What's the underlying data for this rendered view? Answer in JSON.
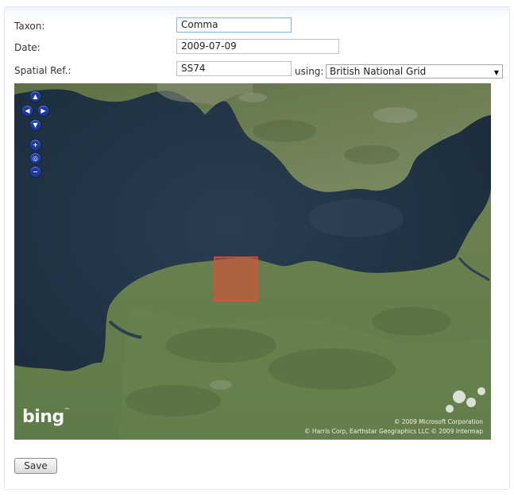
{
  "form": {
    "taxon_label": "Taxon:",
    "taxon_value": "Comma",
    "date_label": "Date:",
    "date_value": "2009-07-09",
    "spatial_label": "Spatial Ref.:",
    "spatial_value": "SS74",
    "using_label": "using:",
    "system_selected": "British National Grid"
  },
  "map": {
    "logo_text": "bing",
    "logo_tm": "™",
    "copyright_line1": "© 2009 Microsoft Corporation",
    "copyright_line2": "© Harris Corp, Earthstar Geographics LLC    © 2009 Intermap",
    "controls": {
      "pan_up": "▲",
      "pan_left": "◀",
      "pan_right": "▶",
      "pan_down": "▼",
      "zoom_in": "+",
      "globe": "◎",
      "zoom_out": "−"
    },
    "selection_color": "#e84a3a",
    "sea_color": "#1f3143",
    "land_color": "#5f7a4a"
  },
  "actions": {
    "save_label": "Save"
  }
}
